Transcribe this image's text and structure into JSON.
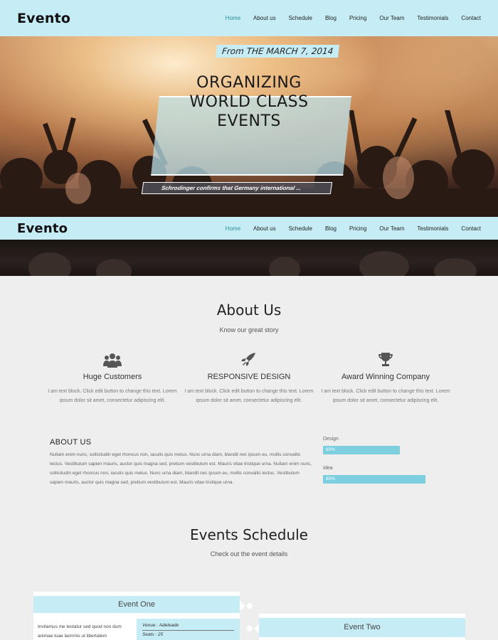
{
  "brand": {
    "logo": "Evento"
  },
  "nav": {
    "items": [
      "Home",
      "About us",
      "Schedule",
      "Blog",
      "Pricing",
      "Our Team",
      "Testimonials",
      "Contact"
    ],
    "active": "Home"
  },
  "hero": {
    "date": "From THE MARCH 7, 2014",
    "title_lines": [
      "ORGANIZING",
      "WORLD CLASS",
      "EVENTS"
    ],
    "subtitle": "Schrodinger confirms that Germany international ..."
  },
  "about": {
    "title": "About Us",
    "subtitle": "Know our great story",
    "features": [
      {
        "icon": "users-icon",
        "title": "Huge Customers",
        "text": "I am text block. Click edit button to change this text. Lorem ipsum dolor sit amet, consectetur adipiscing elit."
      },
      {
        "icon": "rocket-icon",
        "title": "RESPONSIVE DESIGN",
        "text": "I am text block. Click edit button to change this text. Lorem ipsum dolor sit amet, consectetur adipiscing elit."
      },
      {
        "icon": "trophy-icon",
        "title": "Award Winning Company",
        "text": "I am text block. Click edit button to change this text. Lorem ipsum dolor sit amet, consectetur adipiscing elit."
      }
    ],
    "heading": "ABOUT US",
    "paragraph": "Nullam enim nunc, sollicitudin eget rhoncus non, iaculis quis metus. Nunc urna diam, blandit nec ipsum eu, mollis convallis lectus. Vestibulum sapien mauris, auctor quis magna sed, pretium vestibulum est. Mauris vitae tristique urna. Nullam enim nunc, sollicitudin eget rhoncus non, iaculis quis metus. Nunc urna diam, blandit nec ipsum eu, mollis convallis lectus. Vestibulum sapien mauris, auctor quis magna sed, pretium vestibulum est. Mauris vitae tristique urna.",
    "skills": [
      {
        "label": "Design",
        "value": 60,
        "text": "60%"
      },
      {
        "label": "Idea",
        "value": 80,
        "text": "80%"
      }
    ]
  },
  "events": {
    "title": "Events Schedule",
    "subtitle": "Check out the event details",
    "items": [
      {
        "name": "Event One",
        "description": "Invitamus me testatur sed quod non dum animae tuae lacrimis ut libertatem",
        "venue": "Venue : Adeleade",
        "seats": "Seats : 25"
      },
      {
        "name": "Event Two"
      }
    ]
  },
  "colors": {
    "accent": "#c6edf5",
    "active_link": "#2b8f9e",
    "skill_bar": "#7dcfe0",
    "background": "#eeeeee"
  }
}
